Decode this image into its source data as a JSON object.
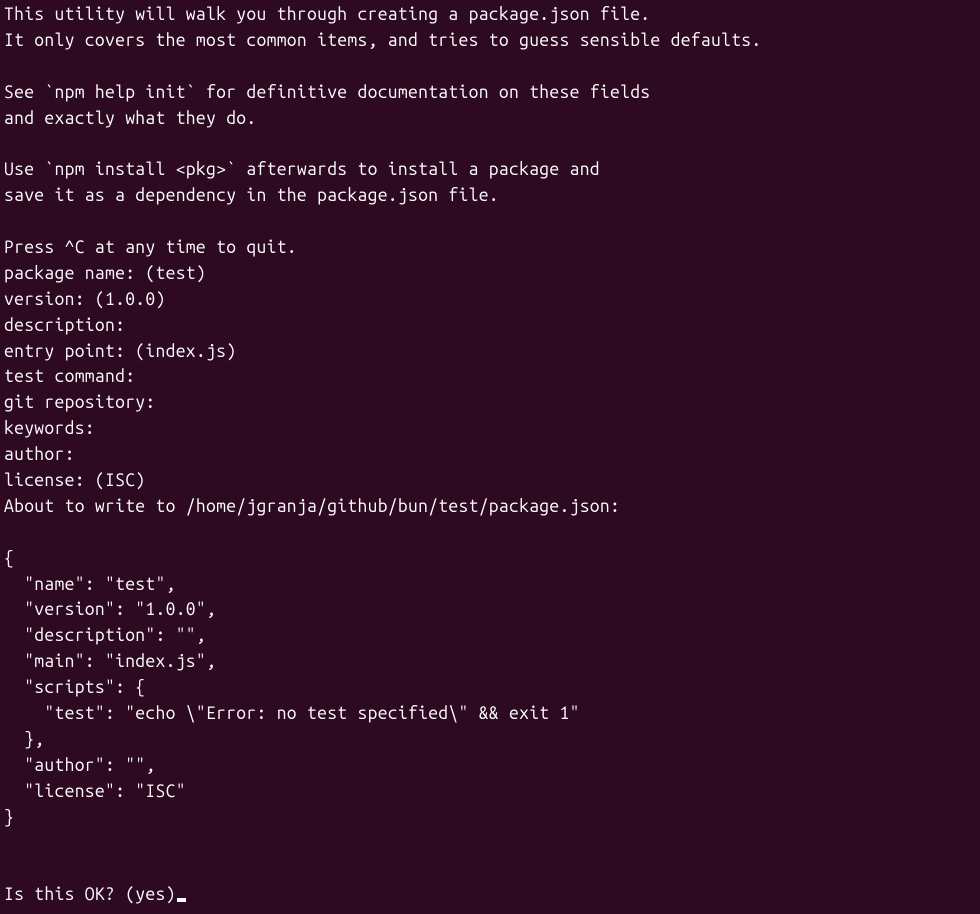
{
  "terminal": {
    "intro": {
      "line1": "This utility will walk you through creating a package.json file.",
      "line2": "It only covers the most common items, and tries to guess sensible defaults.",
      "blank1": "",
      "line3": "See `npm help init` for definitive documentation on these fields",
      "line4": "and exactly what they do.",
      "blank2": "",
      "line5": "Use `npm install <pkg>` afterwards to install a package and",
      "line6": "save it as a dependency in the package.json file.",
      "blank3": "",
      "line7": "Press ^C at any time to quit."
    },
    "prompts": {
      "package_name": "package name: (test)",
      "version": "version: (1.0.0)",
      "description": "description:",
      "entry_point": "entry point: (index.js)",
      "test_command": "test command:",
      "git_repository": "git repository:",
      "keywords": "keywords:",
      "author": "author:",
      "license": "license: (ISC)"
    },
    "about_to_write": "About to write to /home/jgranja/github/bun/test/package.json:",
    "json_output": {
      "open": "{",
      "name": "  \"name\": \"test\",",
      "version": "  \"version\": \"1.0.0\",",
      "description": "  \"description\": \"\",",
      "main": "  \"main\": \"index.js\",",
      "scripts_open": "  \"scripts\": {",
      "test": "    \"test\": \"echo \\\"Error: no test specified\\\" && exit 1\"",
      "scripts_close": "  },",
      "author": "  \"author\": \"\",",
      "license": "  \"license\": \"ISC\"",
      "close": "}"
    },
    "confirm": "Is this OK? (yes)"
  }
}
